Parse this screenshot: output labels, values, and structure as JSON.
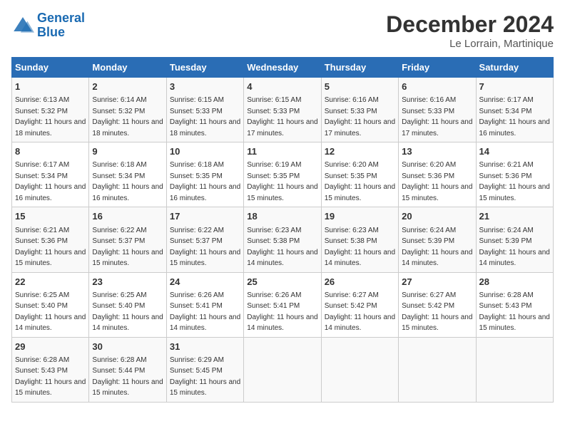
{
  "header": {
    "logo_line1": "General",
    "logo_line2": "Blue",
    "month_title": "December 2024",
    "location": "Le Lorrain, Martinique"
  },
  "weekdays": [
    "Sunday",
    "Monday",
    "Tuesday",
    "Wednesday",
    "Thursday",
    "Friday",
    "Saturday"
  ],
  "weeks": [
    [
      {
        "day": "1",
        "sunrise": "6:13 AM",
        "sunset": "5:32 PM",
        "daylight": "11 hours and 18 minutes."
      },
      {
        "day": "2",
        "sunrise": "6:14 AM",
        "sunset": "5:32 PM",
        "daylight": "11 hours and 18 minutes."
      },
      {
        "day": "3",
        "sunrise": "6:15 AM",
        "sunset": "5:33 PM",
        "daylight": "11 hours and 18 minutes."
      },
      {
        "day": "4",
        "sunrise": "6:15 AM",
        "sunset": "5:33 PM",
        "daylight": "11 hours and 17 minutes."
      },
      {
        "day": "5",
        "sunrise": "6:16 AM",
        "sunset": "5:33 PM",
        "daylight": "11 hours and 17 minutes."
      },
      {
        "day": "6",
        "sunrise": "6:16 AM",
        "sunset": "5:33 PM",
        "daylight": "11 hours and 17 minutes."
      },
      {
        "day": "7",
        "sunrise": "6:17 AM",
        "sunset": "5:34 PM",
        "daylight": "11 hours and 16 minutes."
      }
    ],
    [
      {
        "day": "8",
        "sunrise": "6:17 AM",
        "sunset": "5:34 PM",
        "daylight": "11 hours and 16 minutes."
      },
      {
        "day": "9",
        "sunrise": "6:18 AM",
        "sunset": "5:34 PM",
        "daylight": "11 hours and 16 minutes."
      },
      {
        "day": "10",
        "sunrise": "6:18 AM",
        "sunset": "5:35 PM",
        "daylight": "11 hours and 16 minutes."
      },
      {
        "day": "11",
        "sunrise": "6:19 AM",
        "sunset": "5:35 PM",
        "daylight": "11 hours and 15 minutes."
      },
      {
        "day": "12",
        "sunrise": "6:20 AM",
        "sunset": "5:35 PM",
        "daylight": "11 hours and 15 minutes."
      },
      {
        "day": "13",
        "sunrise": "6:20 AM",
        "sunset": "5:36 PM",
        "daylight": "11 hours and 15 minutes."
      },
      {
        "day": "14",
        "sunrise": "6:21 AM",
        "sunset": "5:36 PM",
        "daylight": "11 hours and 15 minutes."
      }
    ],
    [
      {
        "day": "15",
        "sunrise": "6:21 AM",
        "sunset": "5:36 PM",
        "daylight": "11 hours and 15 minutes."
      },
      {
        "day": "16",
        "sunrise": "6:22 AM",
        "sunset": "5:37 PM",
        "daylight": "11 hours and 15 minutes."
      },
      {
        "day": "17",
        "sunrise": "6:22 AM",
        "sunset": "5:37 PM",
        "daylight": "11 hours and 15 minutes."
      },
      {
        "day": "18",
        "sunrise": "6:23 AM",
        "sunset": "5:38 PM",
        "daylight": "11 hours and 14 minutes."
      },
      {
        "day": "19",
        "sunrise": "6:23 AM",
        "sunset": "5:38 PM",
        "daylight": "11 hours and 14 minutes."
      },
      {
        "day": "20",
        "sunrise": "6:24 AM",
        "sunset": "5:39 PM",
        "daylight": "11 hours and 14 minutes."
      },
      {
        "day": "21",
        "sunrise": "6:24 AM",
        "sunset": "5:39 PM",
        "daylight": "11 hours and 14 minutes."
      }
    ],
    [
      {
        "day": "22",
        "sunrise": "6:25 AM",
        "sunset": "5:40 PM",
        "daylight": "11 hours and 14 minutes."
      },
      {
        "day": "23",
        "sunrise": "6:25 AM",
        "sunset": "5:40 PM",
        "daylight": "11 hours and 14 minutes."
      },
      {
        "day": "24",
        "sunrise": "6:26 AM",
        "sunset": "5:41 PM",
        "daylight": "11 hours and 14 minutes."
      },
      {
        "day": "25",
        "sunrise": "6:26 AM",
        "sunset": "5:41 PM",
        "daylight": "11 hours and 14 minutes."
      },
      {
        "day": "26",
        "sunrise": "6:27 AM",
        "sunset": "5:42 PM",
        "daylight": "11 hours and 14 minutes."
      },
      {
        "day": "27",
        "sunrise": "6:27 AM",
        "sunset": "5:42 PM",
        "daylight": "11 hours and 15 minutes."
      },
      {
        "day": "28",
        "sunrise": "6:28 AM",
        "sunset": "5:43 PM",
        "daylight": "11 hours and 15 minutes."
      }
    ],
    [
      {
        "day": "29",
        "sunrise": "6:28 AM",
        "sunset": "5:43 PM",
        "daylight": "11 hours and 15 minutes."
      },
      {
        "day": "30",
        "sunrise": "6:28 AM",
        "sunset": "5:44 PM",
        "daylight": "11 hours and 15 minutes."
      },
      {
        "day": "31",
        "sunrise": "6:29 AM",
        "sunset": "5:45 PM",
        "daylight": "11 hours and 15 minutes."
      },
      null,
      null,
      null,
      null
    ]
  ]
}
